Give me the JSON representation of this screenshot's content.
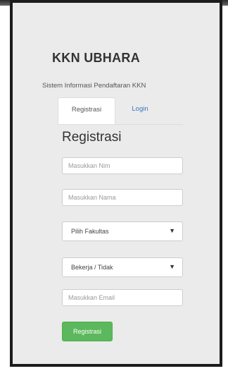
{
  "app": {
    "title": "KKN UBHARA",
    "subtitle": "Sistem Informasi Pendaftaran KKN"
  },
  "tabs": [
    {
      "label": "Registrasi",
      "active": true
    },
    {
      "label": "Login",
      "active": false
    }
  ],
  "form": {
    "heading": "Registrasi",
    "nim_placeholder": "Masukkan Nim",
    "nama_placeholder": "Masukkan Nama",
    "fakultas_select": "Pilih Fakultas",
    "bekerja_select": "Bekerja / Tidak",
    "email_placeholder": "Masukkan Email",
    "submit_label": "Registrasi"
  },
  "colors": {
    "accent_link": "#337ab7",
    "submit_button": "#5cb85c"
  }
}
